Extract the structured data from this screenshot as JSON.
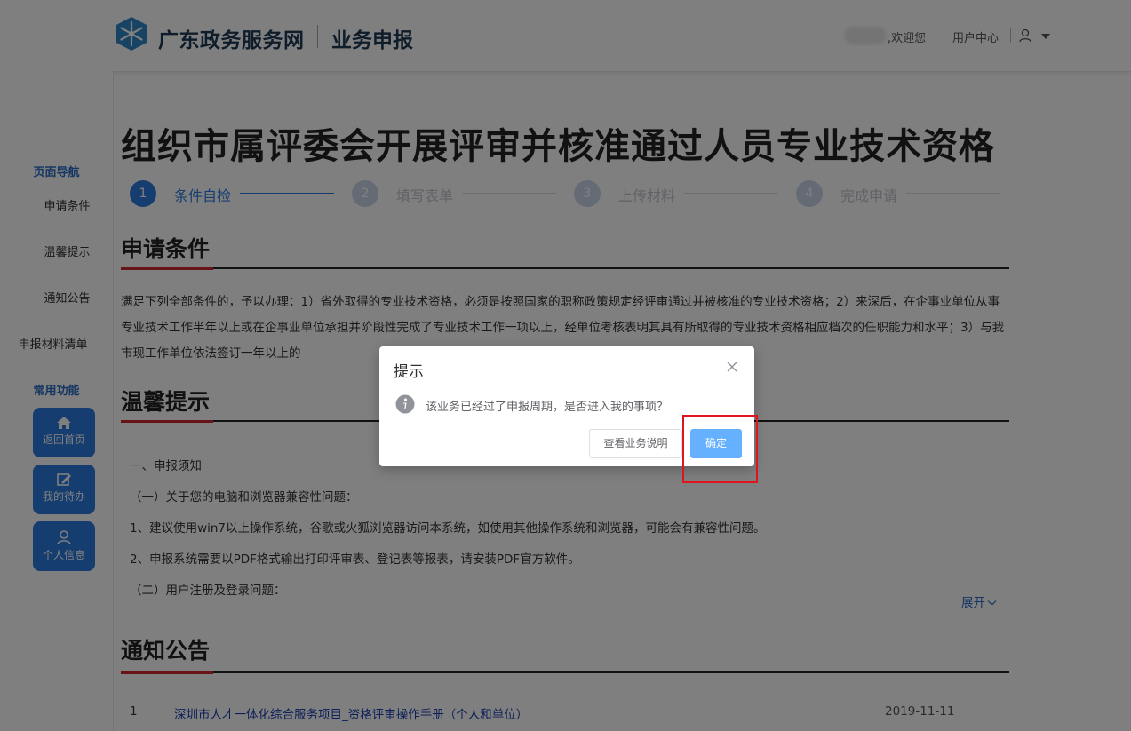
{
  "header": {
    "brand": "广东政务服务网",
    "subtitle": "业务申报",
    "welcome": ",欢迎您",
    "user_center": "用户中心",
    "logo_icon": "snowflake-logo-icon",
    "user_icon": "user-icon",
    "dropdown_icon": "caret-down-icon",
    "brand_color": "#1f3a57"
  },
  "sidebar": {
    "nav_title": "页面导航",
    "nav_items": [
      "申请条件",
      "温馨提示",
      "通知公告",
      "申报材料清单"
    ],
    "func_title": "常用功能",
    "func_buttons": [
      {
        "label": "返回首页",
        "icon": "home-icon"
      },
      {
        "label": "我的待办",
        "icon": "edit-icon"
      },
      {
        "label": "个人信息",
        "icon": "person-icon"
      }
    ],
    "accent_color": "#2c7be0"
  },
  "page": {
    "title": "组织市属评委会开展评审并核准通过人员专业技术资格",
    "steps": [
      {
        "num": "1",
        "label": "条件自检",
        "active": true
      },
      {
        "num": "2",
        "label": "填写表单",
        "active": false
      },
      {
        "num": "3",
        "label": "上传材料",
        "active": false
      },
      {
        "num": "4",
        "label": "完成申请",
        "active": false
      }
    ],
    "conditions": {
      "title": "申请条件",
      "text": "满足下列全部条件的，予以办理：1）省外取得的专业技术资格，必须是按照国家的职称政策规定经评审通过并被核准的专业技术资格；2）来深后，在企事业单位从事专业技术工作半年以上或在企事业单位承担并阶段性完成了专业技术工作一项以上，经单位考核表明其具有所取得的专业技术资格相应档次的任职能力和水平；3）与我市现工作单位依法签订一年以上的"
    },
    "tips": {
      "title": "温馨提示",
      "lines": [
        "一、申报须知",
        "（一）关于您的电脑和浏览器兼容性问题：",
        "1、建议使用win7以上操作系统，谷歌或火狐浏览器访问本系统，如使用其他操作系统和浏览器，可能会有兼容性问题。",
        "2、申报系统需要以PDF格式输出打印评审表、登记表等报表，请安装PDF官方软件。",
        "（二）用户注册及登录问题："
      ],
      "expand": "展开"
    },
    "notices": {
      "title": "通知公告",
      "items": [
        {
          "num": "1",
          "title": "深圳市人才一体化综合服务项目_资格评审操作手册（个人和单位）",
          "date": "2019-11-11"
        }
      ]
    },
    "accent_red": "#d0262a"
  },
  "dialog": {
    "title": "提示",
    "message": "该业务已经过了申报周期，是否进入我的事项？",
    "btn_explain": "查看业务说明",
    "btn_confirm": "确定",
    "info_icon": "info-icon",
    "close_icon": "close-icon",
    "confirm_color": "#66b1ff"
  }
}
